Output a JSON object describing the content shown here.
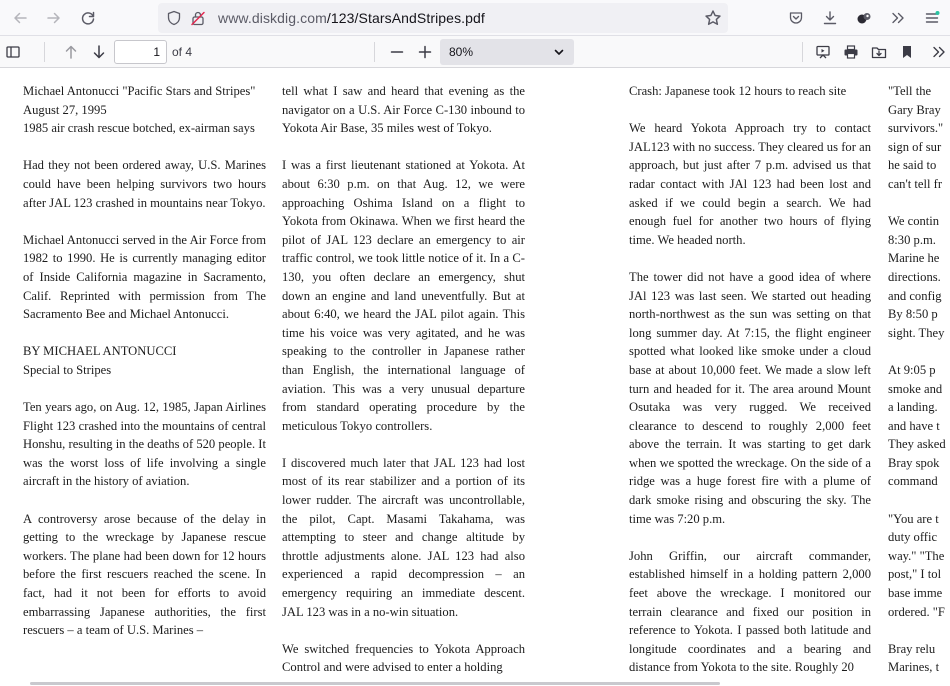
{
  "browser": {
    "url_host": "www.diskdig.com",
    "url_path": "/123/StarsAndStripes.pdf"
  },
  "pdf_toolbar": {
    "current_page": "1",
    "page_count": "of 4",
    "zoom": "80%"
  },
  "document": {
    "column1": [
      [
        "Michael Antonucci \"Pacific Stars and Stripes\"",
        "August 27, 1995",
        "1985 air crash rescue botched, ex-airman says"
      ],
      "Had they not been ordered away, U.S. Marines could have been helping survivors two hours after JAL 123 crashed in mountains near Tokyo.",
      "Michael Antonucci served in the Air Force from 1982 to 1990. He is currently managing editor of Inside California magazine in Sacramento, Calif. Reprinted with permission from The Sacramento Bee and Michael Antonucci.",
      [
        "BY MICHAEL ANTONUCCI",
        "Special to Stripes"
      ],
      "Ten years ago, on Aug. 12, 1985, Japan Airlines Flight 123 crashed into the mountains of central Honshu, resulting in the deaths of 520 people. It was the worst loss of life involving a single aircraft in the history of aviation.",
      "A controversy arose because of the delay in getting to the wreckage by Japanese rescue workers. The plane had been down for 12 hours before the first rescuers reached the scene. In fact, had it not been for efforts to avoid embarrassing Japanese authorities, the first rescuers – a team of U.S. Marines –"
    ],
    "column2": [
      "tell what I saw and heard that evening as the navigator on a U.S. Air Force C-130 inbound to Yokota Air Base, 35 miles west of Tokyo.",
      "I was a first lieutenant stationed at Yokota. At about 6:30 p.m. on that Aug. 12, we were approaching Oshima Island on a flight to Yokota from Okinawa. When we first heard the pilot of JAL 123 declare an emergency to air traffic control, we took little notice of it. In a C-130, you often declare an emergency, shut down an engine and land uneventfully. But at about 6:40, we heard the JAL pilot again. This time his voice was very agitated, and he was speaking to the controller in Japanese rather than English, the international language of aviation. This was a very unusual departure from standard operating procedure by the meticulous Tokyo controllers.",
      "I discovered much later that JAL 123 had lost most of its rear stabilizer and a portion of its lower rudder. The aircraft was uncontrollable, the pilot, Capt. Masami Takahama, was attempting to steer and change altitude by throttle adjustments alone. JAL 123 had also experienced a rapid decompression – an emergency requiring an immediate descent. JAL 123 was in a no-win situation.",
      "We switched frequencies to Yokota Approach Control and were advised to enter a holding"
    ],
    "column3": [
      "Crash: Japanese took 12 hours to reach site",
      "We heard Yokota Approach try to contact JAL123 with no success. They cleared us for an approach, but just after 7 p.m. advised us that radar contact with JAl 123 had been lost and asked if we could begin a search. We had enough fuel for another two hours of flying time. We headed north.",
      "The tower did not have a good idea of where JAl 123 was last seen. We started out heading north-northwest as the sun was setting on that long summer day. At 7:15, the flight engineer spotted what looked like smoke under a cloud base at about 10,000 feet. We made a slow left turn and headed for it. The area around Mount Osutaka was very rugged. We received clearance to descend to roughly 2,000 feet above the terrain. It was starting to get dark when we spotted the wreckage. On the side of a ridge was a huge forest fire with a plume of dark smoke rising and obscuring the sky. The time was 7:20 p.m.",
      "John Griffin, our aircraft commander, established himself in a holding pattern 2,000 feet above the wreckage. I monitored our terrain clearance and fixed our position in reference to Yokota. I passed both latitude and longitude coordinates and a bearing and distance from Yokota to the site. Roughly 20"
    ],
    "column4": [
      [
        "\"Tell the",
        "Gary Bray",
        "survivors.\"",
        "sign of sur",
        "he said to",
        "can't tell fr"
      ],
      [
        "We contin",
        "8:30 p.m.",
        "Marine he",
        "directions.",
        "and config",
        "By 8:50 p",
        "sight. They"
      ],
      [
        "At 9:05 p",
        "smoke and",
        "a landing.",
        "and have t",
        "They asked",
        "Bray spok",
        "command"
      ],
      [
        "\"You are t",
        "duty offic",
        "way.\" \"The",
        "post,\" I tol",
        "base imme",
        "ordered. \"F"
      ],
      [
        "Bray relu",
        "Marines, t"
      ]
    ]
  }
}
